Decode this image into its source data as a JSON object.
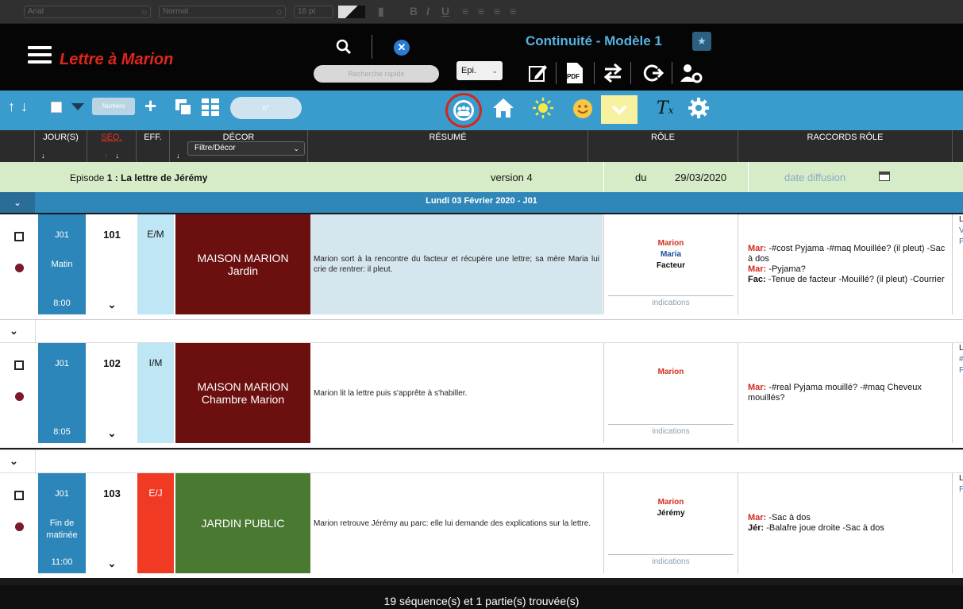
{
  "format_bar": {
    "font": "Arial",
    "style": "Normal",
    "size": "16 pt",
    "bold": "B",
    "italic": "I",
    "underline": "U"
  },
  "header": {
    "app_title": "Lettre à Marion",
    "search_placeholder": "Recherche rapide",
    "episode_select": "Epi.",
    "doc_title": "Continuité - Modèle 1",
    "pdf_label": "PDF",
    "star": "★"
  },
  "toolbar": {
    "numero_placeholder": "Numéro",
    "num_placeholder": "n°",
    "tx": "T",
    "tx_sub": "x"
  },
  "columns": {
    "jours": "JOUR(S)",
    "seq": "SÉQ.",
    "eff": "EFF.",
    "decor": "DÉCOR",
    "decor_filter": "Filtre/Décor",
    "resume": "RÉSUMÉ",
    "role": "RÔLE",
    "raccords": "RACCORDS RÔLE"
  },
  "episode": {
    "prefix": "Episode",
    "number": "1",
    "title": " : La lettre de Jérémy",
    "version_label": "version",
    "version": "4",
    "du_label": "du",
    "date": "29/03/2020",
    "date_diffusion": "date diffusion"
  },
  "day": {
    "title": "Lundi 03 Février 2020 - J01"
  },
  "sequences": [
    {
      "day": "J01",
      "period": "Matin",
      "time": "8:00",
      "number": "101",
      "eff": "E/M",
      "eff_color": "#bfe6f5",
      "decor_line1": "MAISON MARION",
      "decor_line2": "Jardin",
      "decor_color": "#6b0f0f",
      "summary": "Marion sort à la rencontre du facteur et récupère une lettre; sa mère Maria lui crie de rentrer: il pleut.",
      "summary_bg": "#d6e6ee",
      "roles": [
        "Marion",
        "Maria",
        "Facteur"
      ],
      "role_colors": [
        "#d42b1e",
        "#1b4f9a",
        "#111111"
      ],
      "indications": "indications",
      "raccords": [
        {
          "who": "Mar:",
          "text": " -#cost Pyjama -#maq Mouillée? (il pleut) -Sac à dos"
        },
        {
          "who": "Mar:",
          "text": " -Pyjama?"
        },
        {
          "who": "Fac:",
          "text": " -Tenue de facteur -Mouillé? (il pleut) -Courrier"
        }
      ],
      "edge": [
        "L",
        "V",
        "P"
      ]
    },
    {
      "day": "J01",
      "period": "",
      "time": "8:05",
      "number": "102",
      "eff": "I/M",
      "eff_color": "#bfe6f5",
      "decor_line1": "MAISON MARION",
      "decor_line2": "Chambre Marion",
      "decor_color": "#6b0f0f",
      "summary": "Marion lit la lettre puis s'apprête à s'habiller.",
      "summary_bg": "#ffffff",
      "roles": [
        "Marion"
      ],
      "role_colors": [
        "#d42b1e"
      ],
      "indications": "indications",
      "raccords": [
        {
          "who": "Mar:",
          "text": " -#real Pyjama mouillé? -#maq Cheveux mouillés?"
        }
      ],
      "edge": [
        "L",
        "#",
        "P"
      ]
    },
    {
      "day": "J01",
      "period": "Fin de matinée",
      "time": "11:00",
      "number": "103",
      "eff": "E/J",
      "eff_color": "#f03a24",
      "decor_line1": "JARDIN PUBLIC",
      "decor_line2": "",
      "decor_color": "#4a7a32",
      "summary": "Marion retrouve Jérémy au parc: elle lui demande des explications sur la lettre.",
      "summary_bg": "#ffffff",
      "roles": [
        "Marion",
        "Jérémy"
      ],
      "role_colors": [
        "#d42b1e",
        "#111111"
      ],
      "indications": "indications",
      "raccords": [
        {
          "who": "Mar:",
          "text": " -Sac à dos"
        },
        {
          "who": "Jér:",
          "text": " -Balafre joue droite -Sac à dos"
        }
      ],
      "edge": [
        "L",
        "P"
      ]
    }
  ],
  "footer": {
    "status": "19 séquence(s) et 1 partie(s) trouvée(s)"
  }
}
